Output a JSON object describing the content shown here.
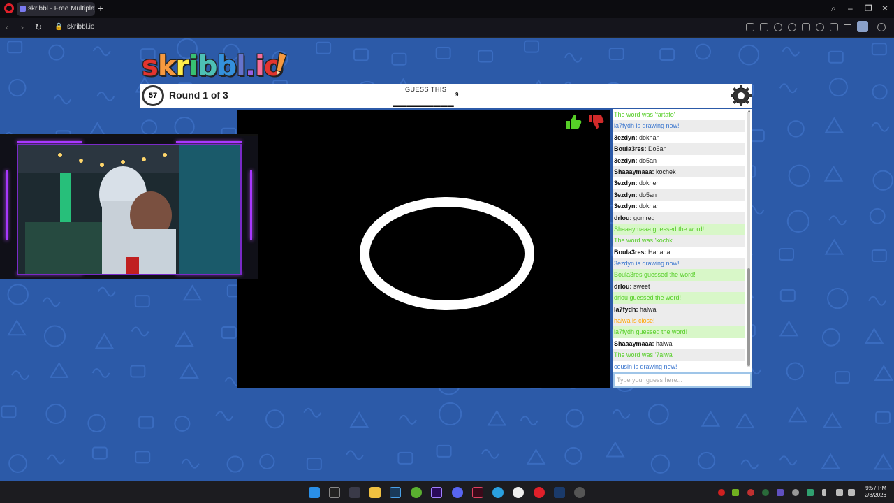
{
  "browser": {
    "tab_title": "skribbl - Free Multiplayer",
    "new_tab": "+",
    "url": "skribbl.io"
  },
  "game": {
    "logo_letters": [
      {
        "ch": "s",
        "color": "#e3342f"
      },
      {
        "ch": "k",
        "color": "#f6993f"
      },
      {
        "ch": "r",
        "color": "#ffed4a"
      },
      {
        "ch": "i",
        "color": "#38c172"
      },
      {
        "ch": "b",
        "color": "#4dc0b5"
      },
      {
        "ch": "b",
        "color": "#3490dc"
      },
      {
        "ch": "l",
        "color": "#6574cd"
      },
      {
        "ch": ".",
        "color": "#9561e2"
      },
      {
        "ch": "i",
        "color": "#f66d9b"
      },
      {
        "ch": "o",
        "color": "#e3342f"
      }
    ],
    "timer": "57",
    "round_text": "Round 1 of 3",
    "guess_label": "GUESS THIS",
    "word_blanks": "_________",
    "word_length": "9"
  },
  "chat": {
    "messages": [
      {
        "type": "system-green",
        "text": "The word was 'fartato'"
      },
      {
        "type": "system-blue",
        "text": "la7fydh is drawing now!"
      },
      {
        "type": "msg",
        "user": "3ezdyn:",
        "text": "dokhan"
      },
      {
        "type": "msg",
        "user": "Boula3res:",
        "text": "Do5an"
      },
      {
        "type": "msg",
        "user": "3ezdyn:",
        "text": "do5an"
      },
      {
        "type": "msg",
        "user": "Shaaaymaaa:",
        "text": "kochek"
      },
      {
        "type": "msg",
        "user": "3ezdyn:",
        "text": "dokhen"
      },
      {
        "type": "msg",
        "user": "3ezdyn:",
        "text": "do5an"
      },
      {
        "type": "msg",
        "user": "3ezdyn:",
        "text": "dokhan"
      },
      {
        "type": "msg",
        "user": "drlou:",
        "text": "gomreg"
      },
      {
        "type": "guessed",
        "text": "Shaaaymaaa guessed the word!"
      },
      {
        "type": "system-green",
        "text": "The word was 'kochk'"
      },
      {
        "type": "msg",
        "user": "Boula3res:",
        "text": "Hahaha"
      },
      {
        "type": "system-blue",
        "text": "3ezdyn is drawing now!"
      },
      {
        "type": "guessed",
        "text": "Boula3res guessed the word!"
      },
      {
        "type": "msg",
        "user": "drlou:",
        "text": "sweet"
      },
      {
        "type": "guessed",
        "text": "drlou guessed the word!"
      },
      {
        "type": "msg",
        "user": "la7fydh:",
        "text": "halwa"
      },
      {
        "type": "close",
        "text": "halwa is close!"
      },
      {
        "type": "guessed",
        "text": "la7fydh guessed the word!"
      },
      {
        "type": "msg",
        "user": "Shaaaymaaa:",
        "text": "halwa"
      },
      {
        "type": "system-green",
        "text": "The word was '7alwa'"
      },
      {
        "type": "system-blue",
        "text": "cousin is drawing now!"
      }
    ],
    "input_placeholder": "Type your guess here..."
  },
  "taskbar": {
    "time": "9:57 PM",
    "date": "2/8/2026"
  }
}
